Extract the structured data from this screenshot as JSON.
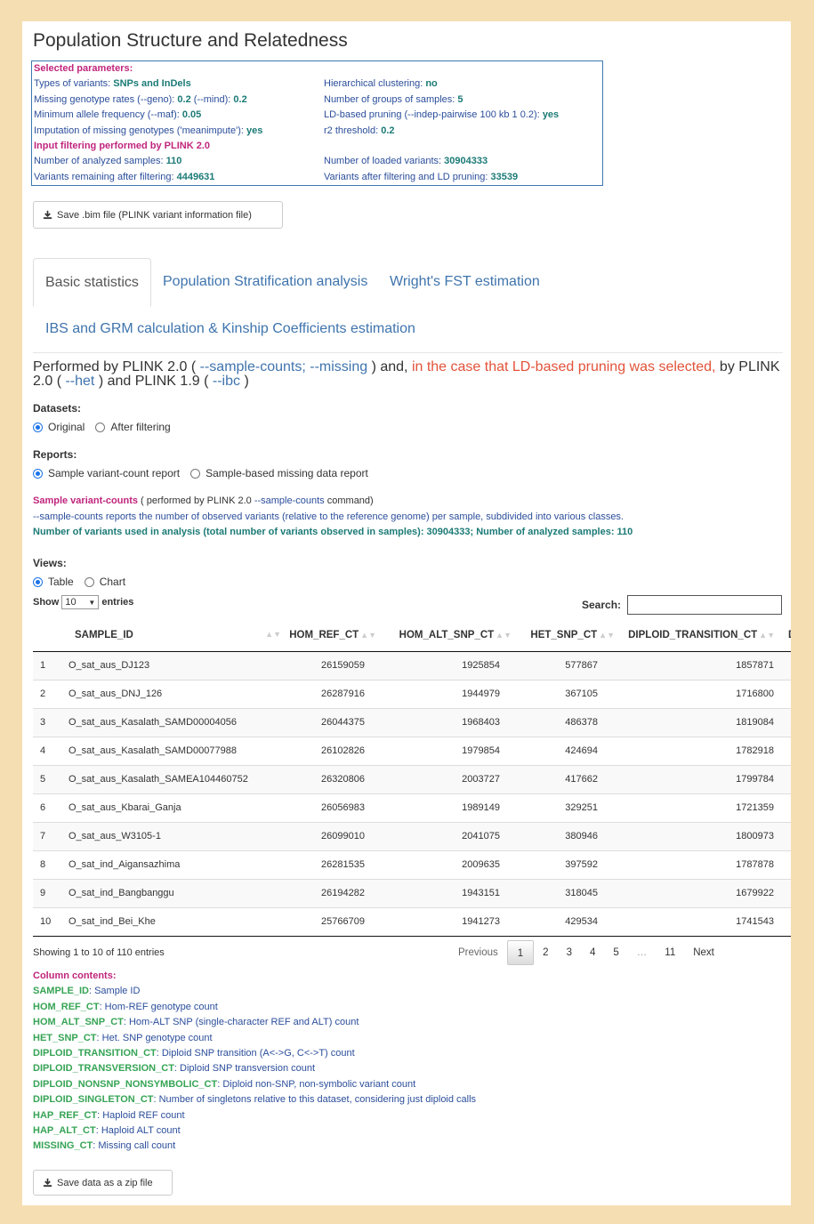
{
  "title": "Population Structure and Relatedness",
  "params": {
    "header": "Selected parameters:",
    "left": [
      {
        "label": "Types of variants: ",
        "value": "SNPs and InDels"
      },
      {
        "label": "Missing genotype rates (--geno): ",
        "value": "0.2",
        "label2": " (--mind): ",
        "value2": "0.2"
      },
      {
        "label": "Minimum allele frequency (--maf): ",
        "value": "0.05"
      },
      {
        "label": "Imputation of missing genotypes ('meanimpute'): ",
        "value": "yes"
      }
    ],
    "right": [
      {
        "label": "Hierarchical clustering: ",
        "value": "no"
      },
      {
        "label": "Number of groups of samples: ",
        "value": "5"
      },
      {
        "label": "LD-based pruning (--indep-pairwise 100 kb 1 0.2): ",
        "value": "yes"
      },
      {
        "label": "r2 threshold: ",
        "value": "0.2"
      }
    ],
    "filter_header": "Input filtering performed by PLINK 2.0",
    "analyzed_label": "Number of analyzed samples: ",
    "analyzed_value": "110",
    "remaining_label": "Variants remaining after filtering: ",
    "remaining_value": "4449631",
    "loaded_label": "Number of loaded variants: ",
    "loaded_value": "30904333",
    "pruned_label": "Variants after filtering and LD pruning: ",
    "pruned_value": "33539"
  },
  "save_bim_label": "Save .bim file (PLINK variant information file)",
  "tabs": [
    "Basic statistics",
    "Population Stratification analysis",
    "Wright's FST estimation",
    "IBS and GRM calculation & Kinship Coefficients estimation"
  ],
  "performed": {
    "p1": "Performed by PLINK 2.0 ( ",
    "l1": "--sample-counts; --missing",
    "p2": " ) and, ",
    "red": "in the case that LD-based pruning was selected,",
    "p3": " by PLINK 2.0 ( ",
    "l2": "--het",
    "p4": " ) and PLINK 1.9 ( ",
    "l3": "--ibc",
    "p5": " )"
  },
  "datasets": {
    "label": "Datasets:",
    "options": [
      "Original",
      "After filtering"
    ]
  },
  "reports": {
    "label": "Reports:",
    "options": [
      "Sample variant-count report",
      "Sample-based missing data report"
    ]
  },
  "svc": {
    "title": "Sample variant-counts",
    "t1": " ( performed by PLINK 2.0 ",
    "cmd": "--sample-counts",
    "t2": " command)",
    "desc_cmd": "--sample-counts",
    "desc": " reports the number of observed variants (relative to the reference genome) per sample, subdivided into various classes.",
    "summary": "Number of variants used in analysis (total number of variants observed in samples): 30904333; Number of analyzed samples: 110"
  },
  "views": {
    "label": "Views:",
    "options": [
      "Table",
      "Chart"
    ]
  },
  "show": {
    "pre": "Show",
    "value": "10",
    "post": "entries"
  },
  "search_label": "Search:",
  "table": {
    "headers": [
      "",
      "SAMPLE_ID",
      "HOM_REF_CT",
      "HOM_ALT_SNP_CT",
      "HET_SNP_CT",
      "DIPLOID_TRANSITION_CT",
      "D"
    ],
    "rows": [
      [
        "1",
        "O_sat_aus_DJ123",
        "26159059",
        "1925854",
        "577867",
        "1857871"
      ],
      [
        "2",
        "O_sat_aus_DNJ_126",
        "26287916",
        "1944979",
        "367105",
        "1716800"
      ],
      [
        "3",
        "O_sat_aus_Kasalath_SAMD00004056",
        "26044375",
        "1968403",
        "486378",
        "1819084"
      ],
      [
        "4",
        "O_sat_aus_Kasalath_SAMD00077988",
        "26102826",
        "1979854",
        "424694",
        "1782918"
      ],
      [
        "5",
        "O_sat_aus_Kasalath_SAMEA104460752",
        "26320806",
        "2003727",
        "417662",
        "1799784"
      ],
      [
        "6",
        "O_sat_aus_Kbarai_Ganja",
        "26056983",
        "1989149",
        "329251",
        "1721359"
      ],
      [
        "7",
        "O_sat_aus_W3105-1",
        "26099010",
        "2041075",
        "380946",
        "1800973"
      ],
      [
        "8",
        "O_sat_ind_Aigansazhima",
        "26281535",
        "2009635",
        "397592",
        "1787878"
      ],
      [
        "9",
        "O_sat_ind_Bangbanggu",
        "26194282",
        "1943151",
        "318045",
        "1679922"
      ],
      [
        "10",
        "O_sat_ind_Bei_Khe",
        "25766709",
        "1941273",
        "429534",
        "1741543"
      ]
    ]
  },
  "info": "Showing 1 to 10 of 110 entries",
  "pager": {
    "previous": "Previous",
    "pages": [
      "1",
      "2",
      "3",
      "4",
      "5",
      "…",
      "11"
    ],
    "next": "Next"
  },
  "column_contents": {
    "header": "Column contents:",
    "items": [
      {
        "key": "SAMPLE_ID",
        "desc": ": Sample ID"
      },
      {
        "key": "HOM_REF_CT",
        "desc": ": Hom-REF genotype count"
      },
      {
        "key": "HOM_ALT_SNP_CT",
        "desc": ": Hom-ALT SNP (single-character REF and ALT) count"
      },
      {
        "key": "HET_SNP_CT",
        "desc": ": Het. SNP genotype count"
      },
      {
        "key": "DIPLOID_TRANSITION_CT",
        "desc": ": Diploid SNP transition (A<->G, C<->T) count"
      },
      {
        "key": "DIPLOID_TRANSVERSION_CT",
        "desc": ": Diploid SNP transversion count"
      },
      {
        "key": "DIPLOID_NONSNP_NONSYMBOLIC_CT",
        "desc": ": Diploid non-SNP, non-symbolic variant count"
      },
      {
        "key": "DIPLOID_SINGLETON_CT",
        "desc": ": Number of singletons relative to this dataset, considering just diploid calls"
      },
      {
        "key": "HAP_REF_CT",
        "desc": ": Haploid REF count"
      },
      {
        "key": "HAP_ALT_CT",
        "desc": ": Haploid ALT count"
      },
      {
        "key": "MISSING_CT",
        "desc": ": Missing call count"
      }
    ]
  },
  "save_zip_label": "Save data as a zip file",
  "colors": {
    "background": "#f6deb3",
    "magenta": "#c0257d",
    "teal": "#1b7a76",
    "link": "#3f74ad",
    "red": "#e2533a",
    "green": "#36a455"
  }
}
